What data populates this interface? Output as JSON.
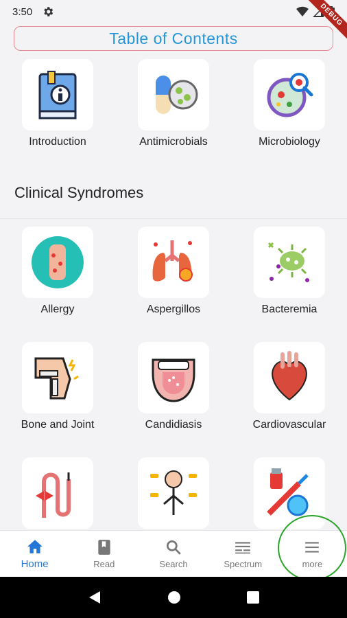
{
  "status_bar": {
    "time": "3:50"
  },
  "debug_banner": {
    "label": "DEBUG"
  },
  "header": {
    "title": "Table of Contents"
  },
  "top_items": [
    {
      "label": "Introduction",
      "icon": "info-book-icon"
    },
    {
      "label": "Antimicrobials",
      "icon": "pill-bacteria-icon"
    },
    {
      "label": "Microbiology",
      "icon": "petri-dish-magnifier-icon"
    }
  ],
  "section": {
    "title": "Clinical Syndromes"
  },
  "syndromes": [
    {
      "label": "Allergy",
      "icon": "allergic-hand-icon"
    },
    {
      "label": "Aspergillos",
      "icon": "infected-lungs-icon"
    },
    {
      "label": "Bacteremia",
      "icon": "bacteria-icon"
    },
    {
      "label": "Bone and Joint",
      "icon": "knee-joint-icon"
    },
    {
      "label": "Candidiasis",
      "icon": "tongue-icon"
    },
    {
      "label": "Cardiovascular",
      "icon": "heart-icon"
    },
    {
      "label": "",
      "icon": "catheter-icon"
    },
    {
      "label": "",
      "icon": "nervous-system-icon"
    },
    {
      "label": "",
      "icon": "syringe-vial-icon"
    }
  ],
  "bottom_nav": [
    {
      "label": "Home",
      "icon": "home-icon",
      "active": true
    },
    {
      "label": "Read",
      "icon": "book-icon",
      "active": false
    },
    {
      "label": "Search",
      "icon": "search-icon",
      "active": false
    },
    {
      "label": "Spectrum",
      "icon": "spectrum-icon",
      "active": false
    },
    {
      "label": "more",
      "icon": "menu-icon",
      "active": false
    }
  ],
  "colors": {
    "accent": "#2477d9",
    "header_text": "#2596d6",
    "header_border": "#e98a91",
    "highlight": "#2aa52a"
  }
}
